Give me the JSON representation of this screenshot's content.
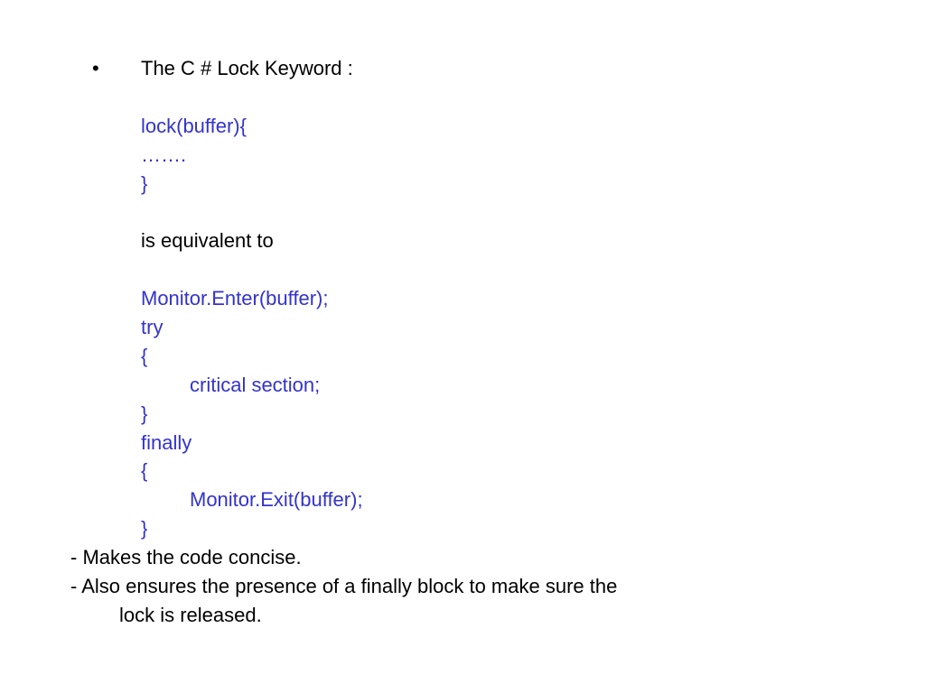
{
  "bullet": {
    "marker": "•",
    "title": "The C # Lock Keyword :",
    "code1_l1": "lock(buffer){",
    "code1_l2": "…….",
    "code1_l3": "}",
    "equiv": " is equivalent to",
    "code2_l1": "Monitor.Enter(buffer);",
    "code2_l2": "try",
    "code2_l3": "{",
    "code2_l4": "critical section;",
    "code2_l5": "}",
    "code2_l6": "finally",
    "code2_l7": "{",
    "code2_l8": "Monitor.Exit(buffer);",
    "code2_l9": "}"
  },
  "footer": {
    "l1": "- Makes the code concise.",
    "l2a": "- Also ensures the presence of a finally block to make sure the",
    "l2b": "lock is released."
  }
}
